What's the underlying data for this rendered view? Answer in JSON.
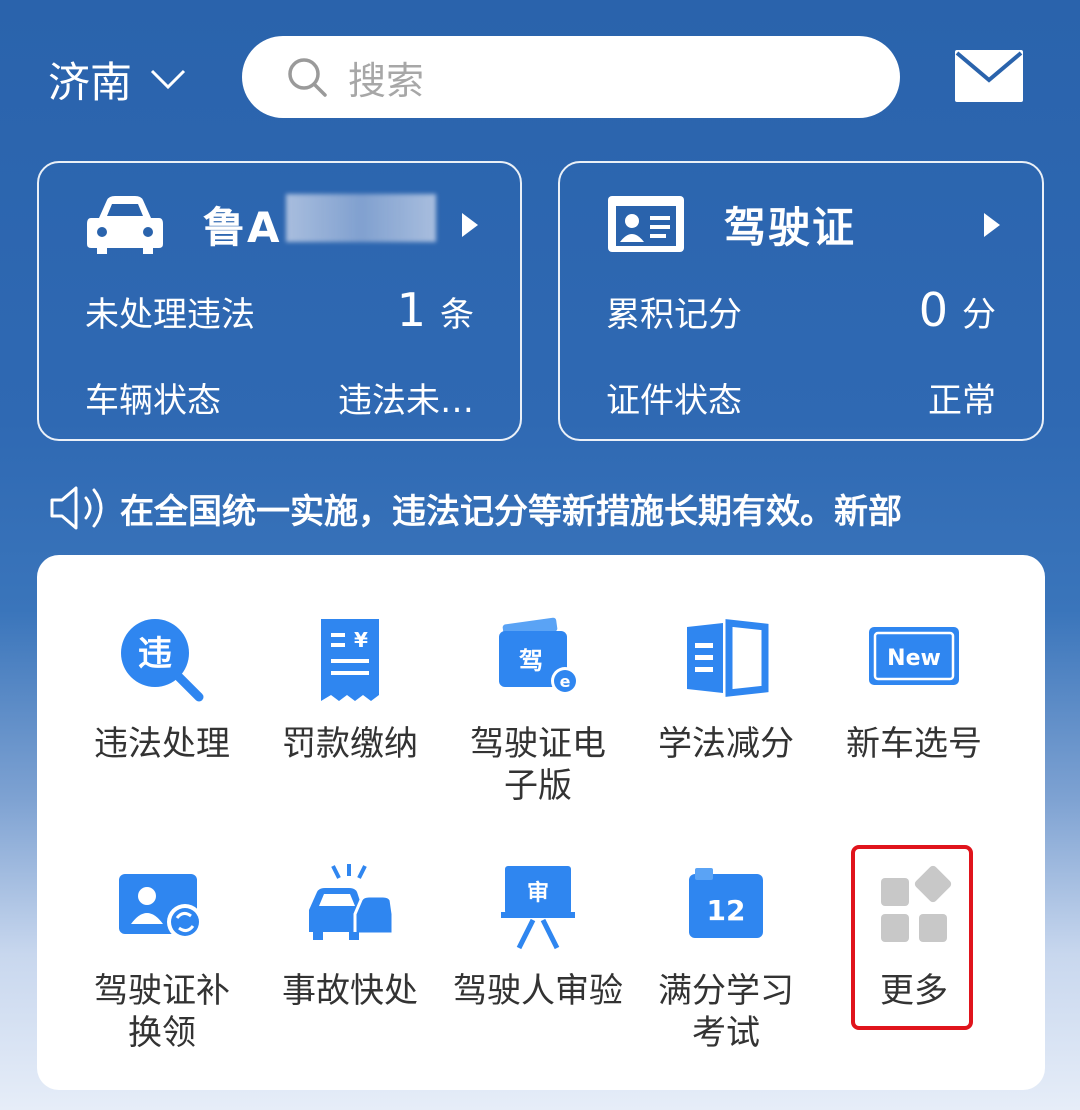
{
  "header": {
    "city": "济南",
    "search_placeholder": "搜索",
    "icons": {
      "city_chevron": "chevron-down-icon",
      "search": "search-icon",
      "message": "mail-icon"
    }
  },
  "vehicle_card": {
    "plate_prefix": "鲁A",
    "row1_label": "未处理违法",
    "row1_value": "1",
    "row1_unit": "条",
    "row2_label": "车辆状态",
    "row2_value": "违法未…",
    "icons": {
      "main": "car-icon",
      "arrow": "triangle-right-icon"
    }
  },
  "license_card": {
    "title": "驾驶证",
    "row1_label": "累积记分",
    "row1_value": "0",
    "row1_unit": "分",
    "row2_label": "证件状态",
    "row2_value": "正常",
    "icons": {
      "main": "id-card-icon",
      "arrow": "triangle-right-icon"
    }
  },
  "notice": {
    "text": "在全国统一实施，违法记分等新措施长期有效。新部",
    "icon": "speaker-icon"
  },
  "services": [
    {
      "label": "违法处理",
      "icon": "violation-search-icon"
    },
    {
      "label": "罚款缴纳",
      "icon": "fine-receipt-icon"
    },
    {
      "label": "驾驶证电\n子版",
      "icon": "e-license-icon"
    },
    {
      "label": "学法减分",
      "icon": "open-book-icon"
    },
    {
      "label": "新车选号",
      "icon": "new-plate-icon"
    },
    {
      "label": "驾驶证补\n换领",
      "icon": "license-replace-icon"
    },
    {
      "label": "事故快处",
      "icon": "car-accident-icon"
    },
    {
      "label": "驾驶人审验",
      "icon": "review-easel-icon"
    },
    {
      "label": "满分学习\n考试",
      "icon": "calendar-12-icon"
    },
    {
      "label": "更多",
      "icon": "more-grid-icon"
    }
  ],
  "colors": {
    "primary_blue": "#2a63ac",
    "icon_blue": "#2f86f0",
    "highlight_red": "#e0141c",
    "more_gray": "#c8c8c8"
  }
}
